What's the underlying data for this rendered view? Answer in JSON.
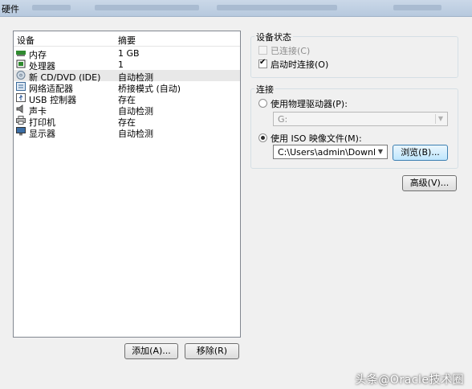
{
  "window": {
    "title": "硬件"
  },
  "device_list": {
    "columns": [
      "设备",
      "摘要"
    ],
    "rows": [
      {
        "name": "内存",
        "summary": "1 GB",
        "icon": "memory-icon"
      },
      {
        "name": "处理器",
        "summary": "1",
        "icon": "processor-icon"
      },
      {
        "name": "新 CD/DVD (IDE)",
        "summary": "自动检测",
        "icon": "cd-dvd-icon",
        "selected": true
      },
      {
        "name": "网络适配器",
        "summary": "桥接模式 (自动)",
        "icon": "network-adapter-icon"
      },
      {
        "name": "USB 控制器",
        "summary": "存在",
        "icon": "usb-icon"
      },
      {
        "name": "声卡",
        "summary": "自动检测",
        "icon": "sound-card-icon"
      },
      {
        "name": "打印机",
        "summary": "存在",
        "icon": "printer-icon"
      },
      {
        "name": "显示器",
        "summary": "自动检测",
        "icon": "display-icon"
      }
    ]
  },
  "buttons": {
    "add": "添加(A)...",
    "remove": "移除(R)",
    "browse": "浏览(B)...",
    "advanced": "高级(V)..."
  },
  "device_status": {
    "title": "设备状态",
    "connected": {
      "label": "已连接(C)",
      "checked": false,
      "enabled": false
    },
    "connect_on_start": {
      "label": "启动时连接(O)",
      "checked": true
    }
  },
  "connection": {
    "title": "连接",
    "physical": {
      "label": "使用物理驱动器(P):",
      "selected": false,
      "drive": "G:"
    },
    "iso": {
      "label": "使用 ISO 映像文件(M):",
      "selected": true,
      "path": "C:\\Users\\admin\\Downloads\\"
    }
  },
  "watermark": "头条@Oracle技术圈"
}
